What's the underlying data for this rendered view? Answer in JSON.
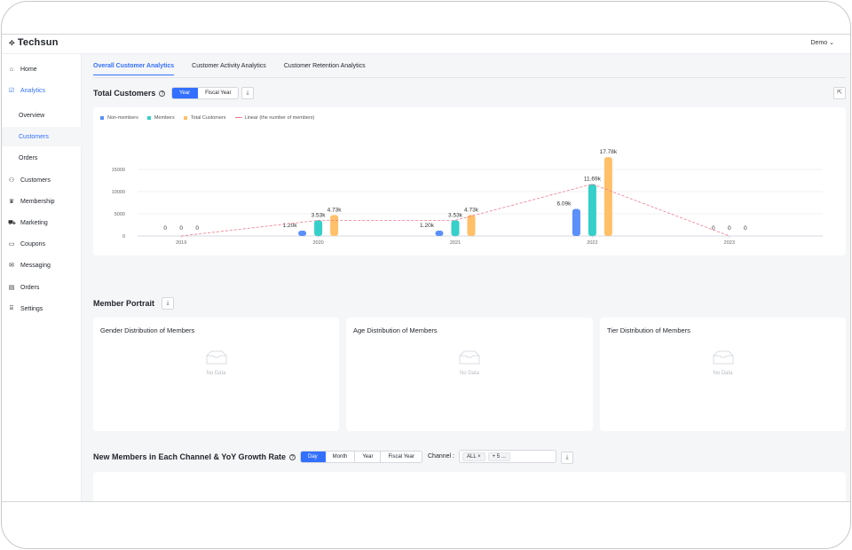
{
  "app": {
    "logo": "Techsun",
    "user": "Demo"
  },
  "sidebar": {
    "items": [
      {
        "label": "Home",
        "icon": "home-icon",
        "glyph": "⌂"
      },
      {
        "label": "Analytics",
        "icon": "analytics-icon",
        "glyph": "☑"
      },
      {
        "label": "Overview"
      },
      {
        "label": "Customers"
      },
      {
        "label": "Orders"
      },
      {
        "label": "Customers",
        "icon": "customers-icon",
        "glyph": "⚇"
      },
      {
        "label": "Membership",
        "icon": "membership-icon",
        "glyph": "♛"
      },
      {
        "label": "Marketing",
        "icon": "marketing-icon",
        "glyph": "⛟"
      },
      {
        "label": "Coupons",
        "icon": "coupons-icon",
        "glyph": "▭"
      },
      {
        "label": "Messaging",
        "icon": "messaging-icon",
        "glyph": "✉"
      },
      {
        "label": "Orders",
        "icon": "orders-icon",
        "glyph": "▤"
      },
      {
        "label": "Settings",
        "icon": "settings-icon",
        "glyph": "⌸"
      }
    ]
  },
  "tabs": [
    "Overall Customer Analytics",
    "Customer Activity Analytics",
    "Customer Retention Analytics"
  ],
  "total_customers": {
    "title": "Total Customers",
    "periods": [
      "Year",
      "Fiscal Year"
    ]
  },
  "chart_data": {
    "type": "bar",
    "categories": [
      "2019",
      "2020",
      "2021",
      "2022",
      "2023"
    ],
    "series": [
      {
        "name": "Non-members",
        "color": "#5b8ff9",
        "values": [
          0,
          1200,
          1200,
          6090,
          0
        ],
        "labels": [
          "0",
          "1.20k",
          "1.20k",
          "6.09k",
          "0"
        ]
      },
      {
        "name": "Members",
        "color": "#36cfc9",
        "values": [
          0,
          3530,
          3530,
          11690,
          0
        ],
        "labels": [
          "0",
          "3.53k",
          "3.53k",
          "11.69k",
          "0"
        ]
      },
      {
        "name": "Total Customers",
        "color": "#ffc069",
        "values": [
          0,
          4730,
          4730,
          17780,
          0
        ],
        "labels": [
          "0",
          "4.73k",
          "4.73k",
          "17.78k",
          "0"
        ]
      }
    ],
    "line": {
      "name": "Linear (the number of members)",
      "color": "#f4778c",
      "values": [
        0,
        3530,
        3530,
        11690,
        0
      ]
    },
    "y_ticks": [
      "0",
      "5000",
      "10000",
      "15000"
    ],
    "ylim": [
      0,
      20000
    ],
    "legend": "top-left",
    "grid": true
  },
  "portrait": {
    "title": "Member Portrait",
    "cards": [
      {
        "title": "Gender Distribution of Members",
        "empty": "No Data"
      },
      {
        "title": "Age Distribution of Members",
        "empty": "No Data"
      },
      {
        "title": "Tier Distribution of Members",
        "empty": "No Data"
      }
    ]
  },
  "new_members": {
    "title": "New Members in Each Channel & YoY Growth Rate",
    "periods": [
      "Day",
      "Month",
      "Year",
      "Fiscal Year"
    ],
    "channel_label": "Channel :",
    "channel_tags": [
      "ALL",
      "+ 5 ..."
    ]
  }
}
